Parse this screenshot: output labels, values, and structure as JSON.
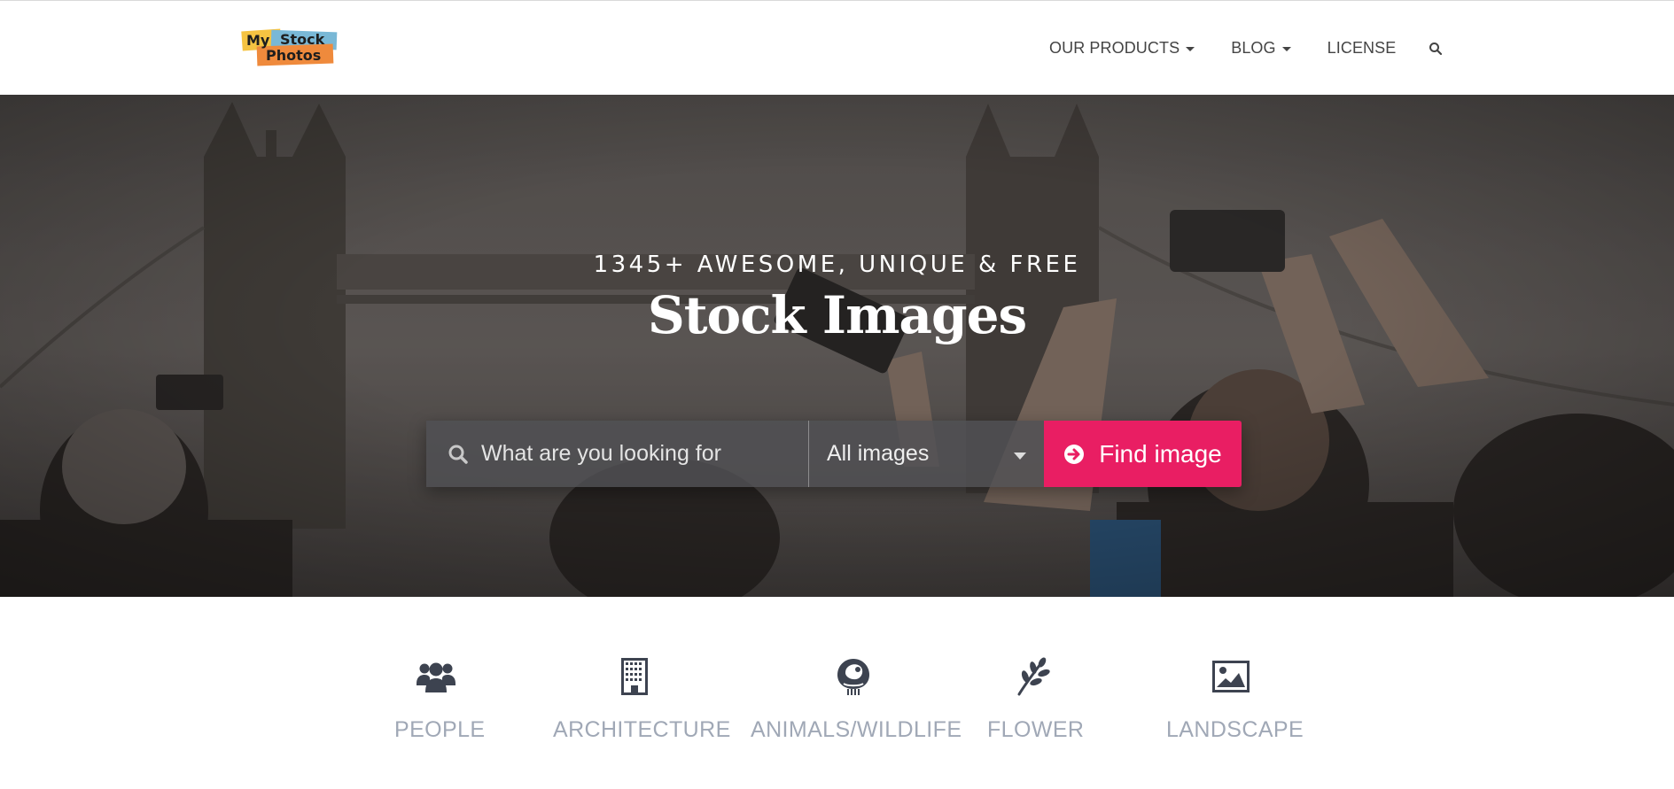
{
  "header": {
    "logo": {
      "line1_a": "My",
      "line1_b": "Stock",
      "line2": "Photos"
    },
    "nav": [
      {
        "label": "OUR PRODUCTS",
        "dropdown": true
      },
      {
        "label": "BLOG",
        "dropdown": true
      },
      {
        "label": "LICENSE",
        "dropdown": false
      }
    ],
    "search_icon": "search-icon"
  },
  "hero": {
    "subtitle": "1345+ AWESOME, UNIQUE & FREE",
    "title": "Stock Images"
  },
  "search": {
    "placeholder": "What are you looking for",
    "type_selected": "All images",
    "button_label": "Find image"
  },
  "categories": [
    {
      "label": "PEOPLE",
      "icon": "people-icon"
    },
    {
      "label": "ARCHITECTURE",
      "icon": "building-icon"
    },
    {
      "label": "ANIMALS/WILDLIFE",
      "icon": "animal-icon"
    },
    {
      "label": "FLOWER",
      "icon": "plant-icon"
    },
    {
      "label": "LANDSCAPE",
      "icon": "landscape-icon"
    }
  ],
  "colors": {
    "accent": "#e91e63",
    "category_label": "#a0a8b6",
    "icon": "#3d4350"
  }
}
